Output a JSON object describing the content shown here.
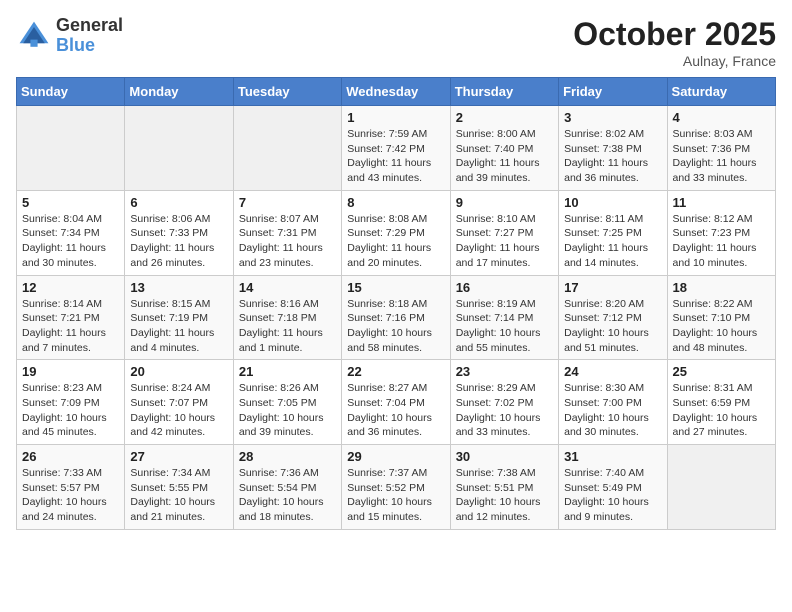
{
  "header": {
    "logo_general": "General",
    "logo_blue": "Blue",
    "month_title": "October 2025",
    "location": "Aulnay, France"
  },
  "weekdays": [
    "Sunday",
    "Monday",
    "Tuesday",
    "Wednesday",
    "Thursday",
    "Friday",
    "Saturday"
  ],
  "weeks": [
    [
      {
        "day": "",
        "info": ""
      },
      {
        "day": "",
        "info": ""
      },
      {
        "day": "",
        "info": ""
      },
      {
        "day": "1",
        "info": "Sunrise: 7:59 AM\nSunset: 7:42 PM\nDaylight: 11 hours\nand 43 minutes."
      },
      {
        "day": "2",
        "info": "Sunrise: 8:00 AM\nSunset: 7:40 PM\nDaylight: 11 hours\nand 39 minutes."
      },
      {
        "day": "3",
        "info": "Sunrise: 8:02 AM\nSunset: 7:38 PM\nDaylight: 11 hours\nand 36 minutes."
      },
      {
        "day": "4",
        "info": "Sunrise: 8:03 AM\nSunset: 7:36 PM\nDaylight: 11 hours\nand 33 minutes."
      }
    ],
    [
      {
        "day": "5",
        "info": "Sunrise: 8:04 AM\nSunset: 7:34 PM\nDaylight: 11 hours\nand 30 minutes."
      },
      {
        "day": "6",
        "info": "Sunrise: 8:06 AM\nSunset: 7:33 PM\nDaylight: 11 hours\nand 26 minutes."
      },
      {
        "day": "7",
        "info": "Sunrise: 8:07 AM\nSunset: 7:31 PM\nDaylight: 11 hours\nand 23 minutes."
      },
      {
        "day": "8",
        "info": "Sunrise: 8:08 AM\nSunset: 7:29 PM\nDaylight: 11 hours\nand 20 minutes."
      },
      {
        "day": "9",
        "info": "Sunrise: 8:10 AM\nSunset: 7:27 PM\nDaylight: 11 hours\nand 17 minutes."
      },
      {
        "day": "10",
        "info": "Sunrise: 8:11 AM\nSunset: 7:25 PM\nDaylight: 11 hours\nand 14 minutes."
      },
      {
        "day": "11",
        "info": "Sunrise: 8:12 AM\nSunset: 7:23 PM\nDaylight: 11 hours\nand 10 minutes."
      }
    ],
    [
      {
        "day": "12",
        "info": "Sunrise: 8:14 AM\nSunset: 7:21 PM\nDaylight: 11 hours\nand 7 minutes."
      },
      {
        "day": "13",
        "info": "Sunrise: 8:15 AM\nSunset: 7:19 PM\nDaylight: 11 hours\nand 4 minutes."
      },
      {
        "day": "14",
        "info": "Sunrise: 8:16 AM\nSunset: 7:18 PM\nDaylight: 11 hours\nand 1 minute."
      },
      {
        "day": "15",
        "info": "Sunrise: 8:18 AM\nSunset: 7:16 PM\nDaylight: 10 hours\nand 58 minutes."
      },
      {
        "day": "16",
        "info": "Sunrise: 8:19 AM\nSunset: 7:14 PM\nDaylight: 10 hours\nand 55 minutes."
      },
      {
        "day": "17",
        "info": "Sunrise: 8:20 AM\nSunset: 7:12 PM\nDaylight: 10 hours\nand 51 minutes."
      },
      {
        "day": "18",
        "info": "Sunrise: 8:22 AM\nSunset: 7:10 PM\nDaylight: 10 hours\nand 48 minutes."
      }
    ],
    [
      {
        "day": "19",
        "info": "Sunrise: 8:23 AM\nSunset: 7:09 PM\nDaylight: 10 hours\nand 45 minutes."
      },
      {
        "day": "20",
        "info": "Sunrise: 8:24 AM\nSunset: 7:07 PM\nDaylight: 10 hours\nand 42 minutes."
      },
      {
        "day": "21",
        "info": "Sunrise: 8:26 AM\nSunset: 7:05 PM\nDaylight: 10 hours\nand 39 minutes."
      },
      {
        "day": "22",
        "info": "Sunrise: 8:27 AM\nSunset: 7:04 PM\nDaylight: 10 hours\nand 36 minutes."
      },
      {
        "day": "23",
        "info": "Sunrise: 8:29 AM\nSunset: 7:02 PM\nDaylight: 10 hours\nand 33 minutes."
      },
      {
        "day": "24",
        "info": "Sunrise: 8:30 AM\nSunset: 7:00 PM\nDaylight: 10 hours\nand 30 minutes."
      },
      {
        "day": "25",
        "info": "Sunrise: 8:31 AM\nSunset: 6:59 PM\nDaylight: 10 hours\nand 27 minutes."
      }
    ],
    [
      {
        "day": "26",
        "info": "Sunrise: 7:33 AM\nSunset: 5:57 PM\nDaylight: 10 hours\nand 24 minutes."
      },
      {
        "day": "27",
        "info": "Sunrise: 7:34 AM\nSunset: 5:55 PM\nDaylight: 10 hours\nand 21 minutes."
      },
      {
        "day": "28",
        "info": "Sunrise: 7:36 AM\nSunset: 5:54 PM\nDaylight: 10 hours\nand 18 minutes."
      },
      {
        "day": "29",
        "info": "Sunrise: 7:37 AM\nSunset: 5:52 PM\nDaylight: 10 hours\nand 15 minutes."
      },
      {
        "day": "30",
        "info": "Sunrise: 7:38 AM\nSunset: 5:51 PM\nDaylight: 10 hours\nand 12 minutes."
      },
      {
        "day": "31",
        "info": "Sunrise: 7:40 AM\nSunset: 5:49 PM\nDaylight: 10 hours\nand 9 minutes."
      },
      {
        "day": "",
        "info": ""
      }
    ]
  ]
}
